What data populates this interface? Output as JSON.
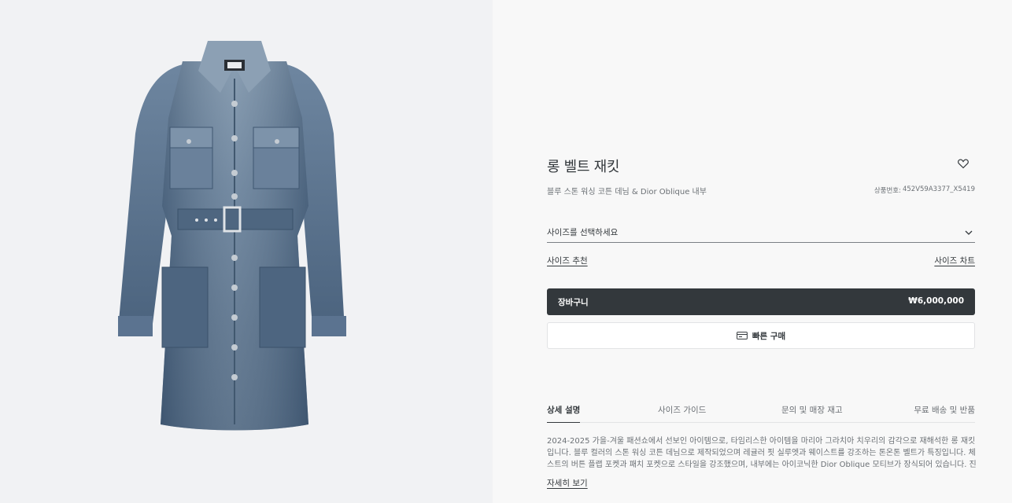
{
  "product": {
    "title": "롱 벨트 재킷",
    "subtitle": "블루 스톤 워싱 코튼 데님 & Dior Oblique 내부",
    "ref_label": "상품번호:",
    "ref_value": "452V59A3377_X5419",
    "image_alt": "denim long belted jacket"
  },
  "size": {
    "placeholder": "사이즈를 선택하세요",
    "recommend_link": "사이즈 추천",
    "chart_link": "사이즈 차트"
  },
  "actions": {
    "cart_label": "장바구니",
    "price": "₩6,000,000",
    "quick_buy_label": "빠른 구매"
  },
  "tabs": [
    {
      "label": "상세 설명",
      "active": true
    },
    {
      "label": "사이즈 가이드",
      "active": false
    },
    {
      "label": "문의 및 매장 재고",
      "active": false
    },
    {
      "label": "무료 배송 및 반품",
      "active": false
    }
  ],
  "description": {
    "text": "2024-2025 가을-겨울 패션쇼에서 선보인 아이템으로, 타임리스한 아이템을 마리아 그라치아 치우리의 감각으로 재해석한 롱 재킷입니다. 블루 컬러의 스톤 워싱 코튼 데님으로 제작되었으며 레귤러 핏 실루엣과 웨이스트를 강조하는 톤온톤 벨트가 특징입니다. 체스트의 버튼 플랩 포켓과 패치 포켓으로 스타일을 강조했으며, 내부에는 아이코닉한 Dior Oblique 모티브가 장식되어 있습니다. 진과 …",
    "more_link": "자세히 보기"
  },
  "colors": {
    "dark": "#33383c",
    "denim": "#4f6680",
    "denim_light": "#8fa2b5",
    "gallery_bg": "#f1f2f4"
  },
  "icons": [
    "heart-icon",
    "chevron-down-icon",
    "card-icon"
  ]
}
